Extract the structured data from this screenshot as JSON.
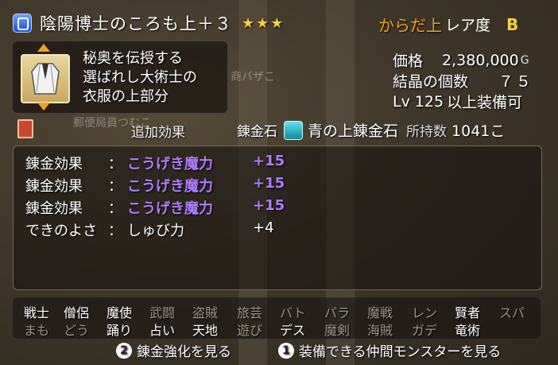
{
  "item": {
    "name": "陰陽博士のころも上＋３",
    "stars": "★★★",
    "category": "からだ上",
    "rarity_label": "レア度",
    "rarity": "B",
    "description": [
      "秘奥を伝授する",
      "選ばれし大術士の",
      "衣服の上部分"
    ]
  },
  "stats": {
    "price_label": "価格",
    "price": "2,380,000",
    "price_unit": "G",
    "crystal_label": "結晶の個数",
    "crystal": "７５",
    "level_prefix": "Lv",
    "level": "125",
    "level_suffix": "以上装備可"
  },
  "section": {
    "extra_label": "追加効果",
    "gem_label": "錬金石",
    "gem_name": "青の上錬金石",
    "count_label": "所持数",
    "count_value": "1041こ"
  },
  "effects": [
    {
      "label": "錬金効果",
      "colon": "：",
      "name": "こうげき魔力",
      "value": "+15"
    },
    {
      "label": "錬金効果",
      "colon": "：",
      "name": "こうげき魔力",
      "value": "+15"
    },
    {
      "label": "錬金効果",
      "colon": "：",
      "name": "こうげき魔力",
      "value": "+15"
    },
    {
      "label": "できのよさ",
      "colon": "：",
      "name": "しゅび力",
      "value": "+4"
    }
  ],
  "jobs_row1": [
    "戦士",
    "僧侶",
    "魔使",
    "武闘",
    "盗賊",
    "旅芸",
    "バト",
    "パラ",
    "魔戦",
    "レン",
    "賢者",
    "スパ"
  ],
  "jobs_row2": [
    "まも",
    "どう",
    "踊り",
    "占い",
    "天地",
    "遊び",
    "デス",
    "魔剣",
    "海賊",
    "ガデ",
    "竜術"
  ],
  "footer": {
    "btn2": "2",
    "btn2_label": "錬金強化を見る",
    "btn1": "1",
    "btn1_label": "装備できる仲間モンスターを見る"
  },
  "background": {
    "shop_sign": "商バザこ",
    "post_sign": "郵便局員つむこ"
  }
}
